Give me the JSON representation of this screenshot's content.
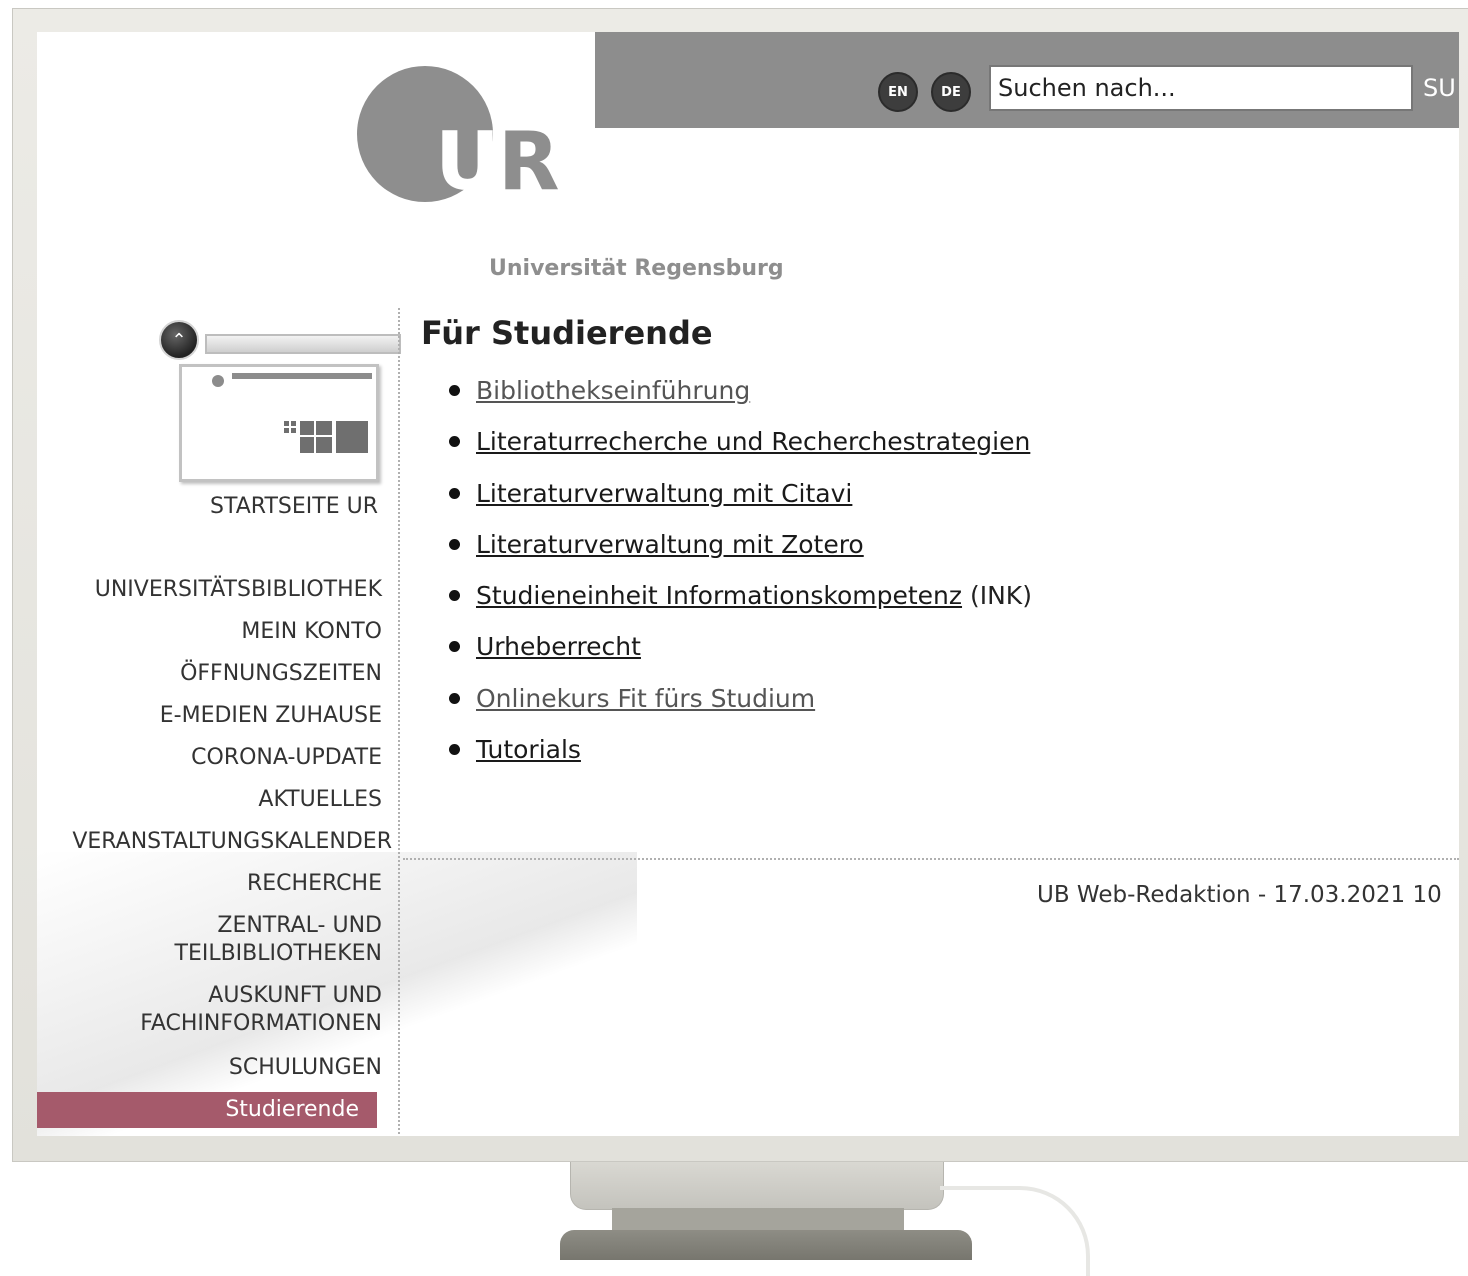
{
  "header": {
    "lang_en": "EN",
    "lang_de": "DE",
    "search_placeholder": "Suchen nach...",
    "search_button": "SU"
  },
  "logo": {
    "letters_u": "U",
    "letters_r": "R",
    "subtitle": "Universität Regensburg"
  },
  "home": {
    "label": "STARTSEITE UR"
  },
  "nav": {
    "items": [
      {
        "label": "UNIVERSITÄTSBIBLIOTHEK"
      },
      {
        "label": "MEIN KONTO"
      },
      {
        "label": "ÖFFNUNGSZEITEN"
      },
      {
        "label": "E-MEDIEN ZUHAUSE"
      },
      {
        "label": "CORONA-UPDATE"
      },
      {
        "label": "AKTUELLES"
      },
      {
        "label": "VERANSTALTUNGSKALENDER"
      },
      {
        "label": "RECHERCHE"
      },
      {
        "label": "ZENTRAL- UND",
        "label2": "TEILBIBLIOTHEKEN"
      },
      {
        "label": "AUSKUNFT UND",
        "label2": "FACHINFORMATIONEN"
      },
      {
        "label": "SCHULUNGEN"
      }
    ],
    "active": "Studierende"
  },
  "main": {
    "title": "Für Studierende",
    "links": [
      {
        "label": "Bibliothekseinführung",
        "suffix": ""
      },
      {
        "label": "Literaturrecherche und Recherchestrategien",
        "suffix": ""
      },
      {
        "label": "Literaturverwaltung mit Citavi",
        "suffix": ""
      },
      {
        "label": "Literaturverwaltung mit Zotero",
        "suffix": ""
      },
      {
        "label": "Studieneinheit Informationskompetenz",
        "suffix": " (INK)"
      },
      {
        "label": "Urheberrecht",
        "suffix": ""
      },
      {
        "label": "Onlinekurs Fit fürs Studium",
        "suffix": ""
      },
      {
        "label": "Tutorials",
        "suffix": ""
      }
    ],
    "footer": "UB Web-Redaktion - 17.03.2021 10"
  }
}
